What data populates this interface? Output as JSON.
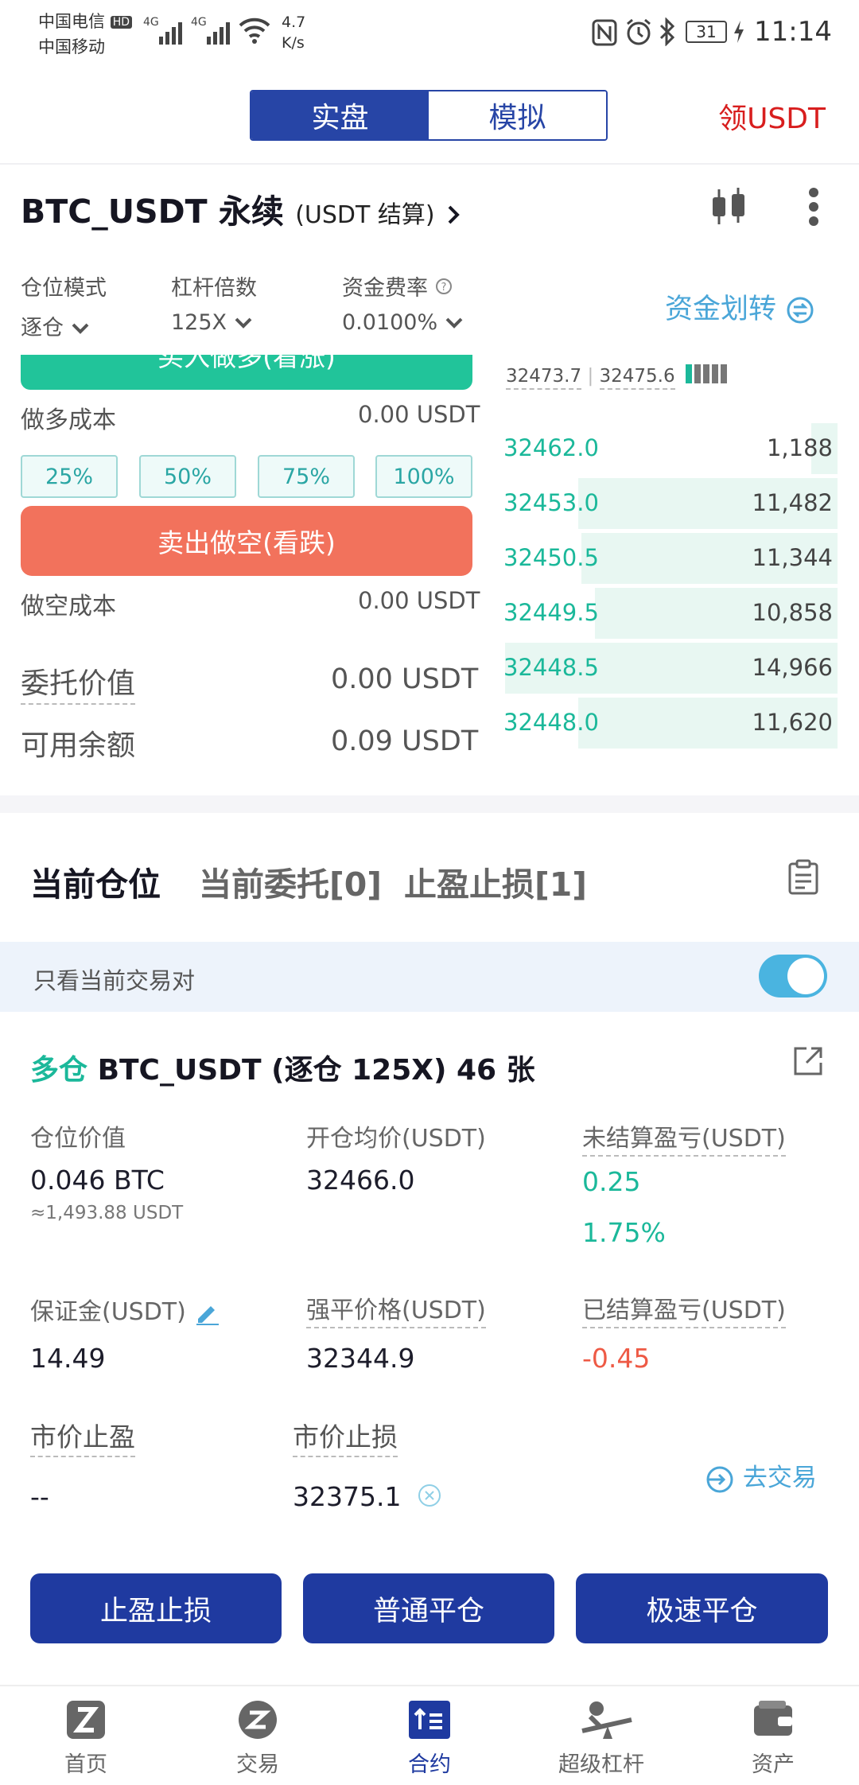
{
  "status": {
    "carrier1": "中国电信",
    "hd": "HD",
    "carrier2": "中国移动",
    "net1": "4G",
    "net2": "4G",
    "speed_value": "4.7",
    "speed_unit": "K/s",
    "battery": "31",
    "time": "11:14"
  },
  "header": {
    "tab_real": "实盘",
    "tab_sim": "模拟",
    "claim_usdt": "领USDT"
  },
  "pair": {
    "name": "BTC_USDT 永续",
    "settle": "(USDT 结算)"
  },
  "params": {
    "margin_mode_label": "仓位模式",
    "margin_mode_value": "逐仓",
    "leverage_label": "杠杆倍数",
    "leverage_value": "125X",
    "funding_label": "资金费率",
    "funding_value": "0.0100%",
    "transfer": "资金划转"
  },
  "order": {
    "buy_long_label": "买入做多(看涨)",
    "long_cost_label": "做多成本",
    "long_cost_value": "0.00 USDT",
    "percents": [
      "25%",
      "50%",
      "75%",
      "100%"
    ],
    "sell_short_label": "卖出做空(看跌)",
    "short_cost_label": "做空成本",
    "short_cost_value": "0.00 USDT",
    "order_value_label": "委托价值",
    "order_value": "0.00 USDT",
    "available_label": "可用余额",
    "available_value": "0.09 USDT"
  },
  "orderbook": {
    "mark_price": "32473.7",
    "index_price": "32475.6",
    "rows": [
      {
        "price": "32462.0",
        "qty": "1,188",
        "depth": 0.08
      },
      {
        "price": "32453.0",
        "qty": "11,482",
        "depth": 0.78
      },
      {
        "price": "32450.5",
        "qty": "11,344",
        "depth": 0.77
      },
      {
        "price": "32449.5",
        "qty": "10,858",
        "depth": 0.73
      },
      {
        "price": "32448.5",
        "qty": "14,966",
        "depth": 1.0
      },
      {
        "price": "32448.0",
        "qty": "11,620",
        "depth": 0.78
      }
    ]
  },
  "tabs": {
    "positions": "当前仓位",
    "open_orders": "当前委托[0]",
    "tpsl": "止盈止损[1]"
  },
  "filter": {
    "only_current_pair": "只看当前交易对",
    "enabled": true
  },
  "position": {
    "side": "多仓",
    "title": "BTC_USDT (逐仓 125X) 46 张",
    "value_label": "仓位价值",
    "value": "0.046 BTC",
    "value_usdt": "≈1,493.88 USDT",
    "entry_label": "开仓均价(USDT)",
    "entry": "32466.0",
    "unrealized_label": "未结算盈亏(USDT)",
    "unrealized": "0.25",
    "unrealized_pct": "1.75%",
    "margin_label": "保证金(USDT)",
    "margin": "14.49",
    "liq_label": "强平价格(USDT)",
    "liq": "32344.9",
    "realized_label": "已结算盈亏(USDT)",
    "realized": "-0.45",
    "tp_label": "市价止盈",
    "tp": "--",
    "sl_label": "市价止损",
    "sl": "32375.1",
    "go_trade": "去交易"
  },
  "actions": {
    "tpsl": "止盈止损",
    "normal_close": "普通平仓",
    "fast_close": "极速平仓"
  },
  "nav": {
    "home": "首页",
    "trade": "交易",
    "contract": "合约",
    "leverage": "超级杠杆",
    "assets": "资产"
  },
  "colors": {
    "brand_blue": "#1f3aa0",
    "long_green": "#1bb89a",
    "short_red": "#f2725c",
    "loss_red": "#ee5a45"
  }
}
